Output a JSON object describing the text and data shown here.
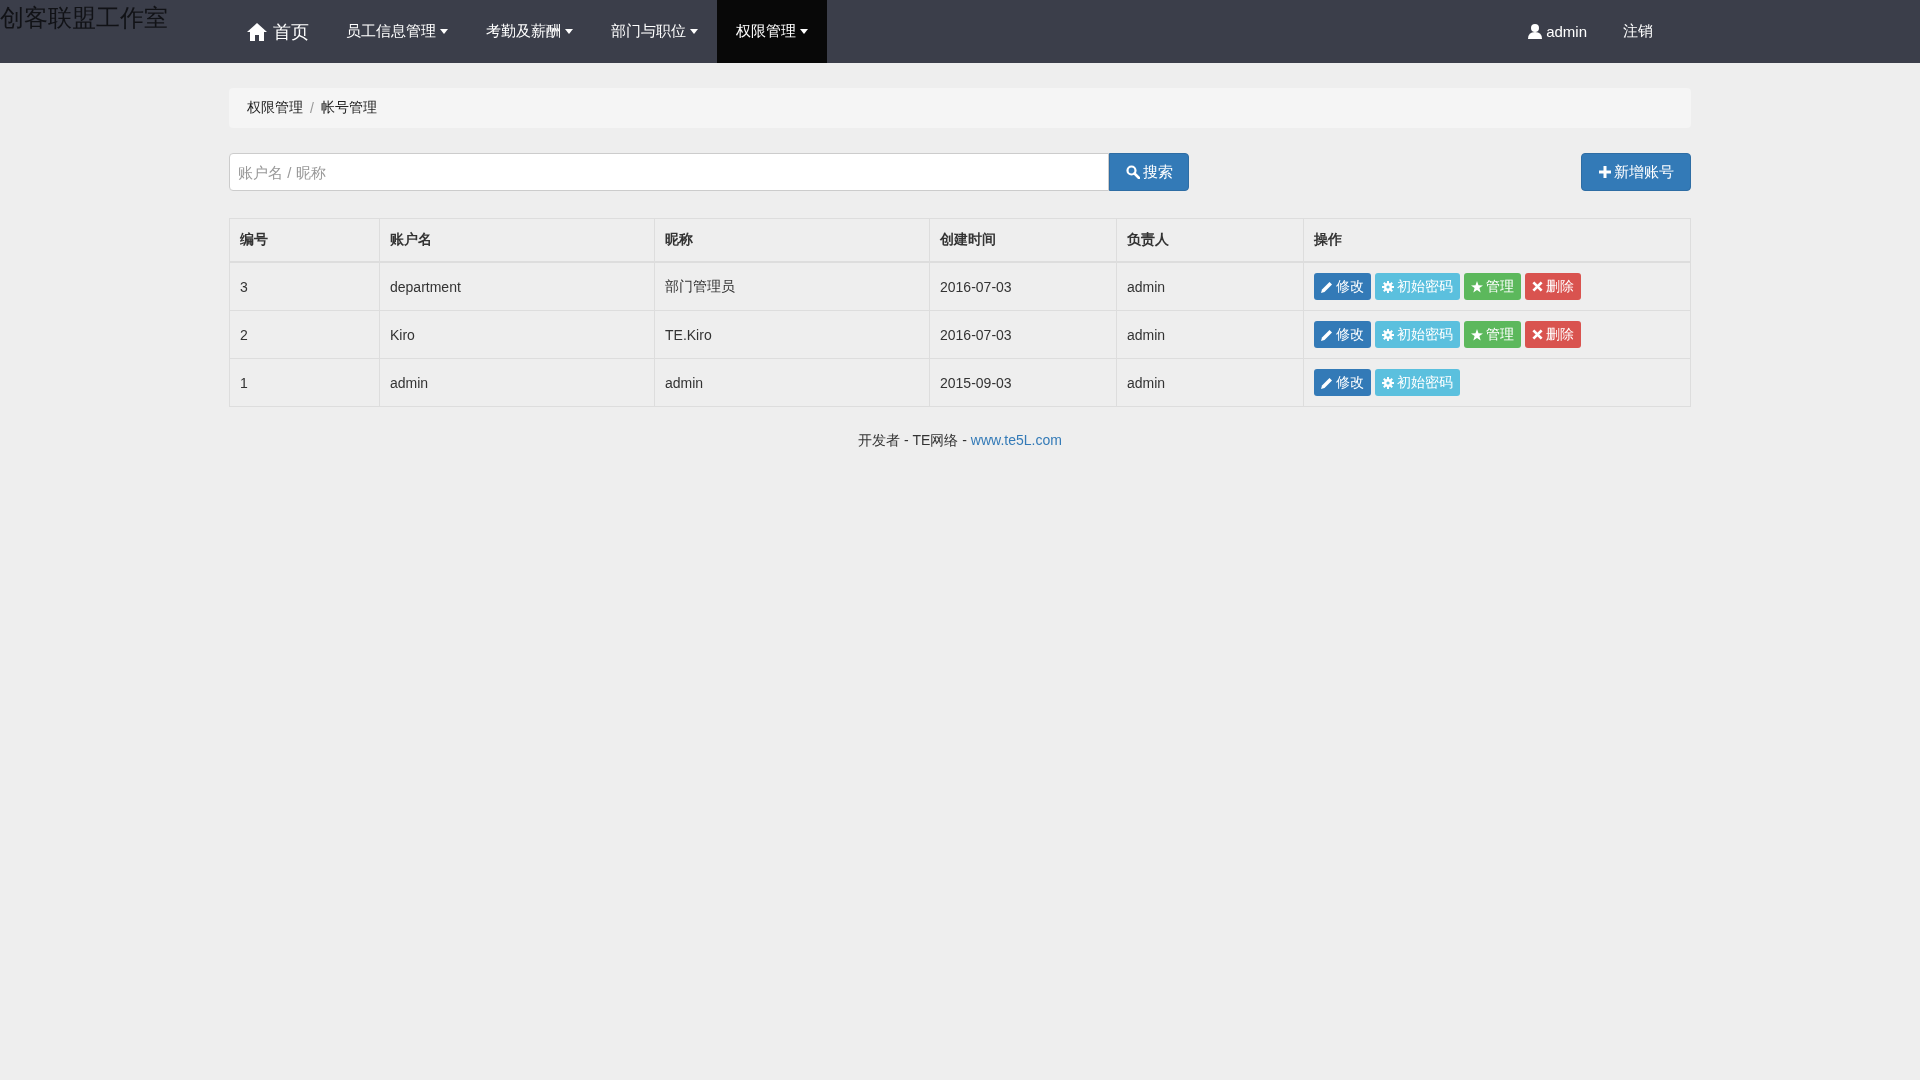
{
  "brand": "创客联盟工作室",
  "nav": {
    "home": "首页",
    "items": [
      {
        "label": "员工信息管理",
        "dropdown": true,
        "selected": false
      },
      {
        "label": "考勤及薪酬",
        "dropdown": true,
        "selected": false
      },
      {
        "label": "部门与职位",
        "dropdown": true,
        "selected": false
      },
      {
        "label": "权限管理",
        "dropdown": true,
        "selected": true
      }
    ],
    "user": "admin",
    "logout": "注销"
  },
  "breadcrumb_separator": "/",
  "breadcrumb": [
    "权限管理",
    "帐号管理"
  ],
  "search": {
    "placeholder": "账户名 / 昵称",
    "button": "搜索"
  },
  "add_button": "新增账号",
  "table": {
    "columns": [
      "编号",
      "账户名",
      "昵称",
      "创建时间",
      "负责人",
      "操作"
    ],
    "rows": [
      {
        "cells": [
          "3",
          "department",
          "部门管理员",
          "2016-07-03",
          "admin"
        ],
        "actions": [
          {
            "kind": "edit",
            "label": "修改"
          },
          {
            "kind": "reset",
            "label": "初始密码"
          },
          {
            "kind": "manage",
            "label": "管理"
          },
          {
            "kind": "delete",
            "label": "删除"
          }
        ]
      },
      {
        "cells": [
          "2",
          "Kiro",
          "TE.Kiro",
          "2016-07-03",
          "admin"
        ],
        "actions": [
          {
            "kind": "edit",
            "label": "修改"
          },
          {
            "kind": "reset",
            "label": "初始密码"
          },
          {
            "kind": "manage",
            "label": "管理"
          },
          {
            "kind": "delete",
            "label": "删除"
          }
        ]
      },
      {
        "cells": [
          "1",
          "admin",
          "admin",
          "2015-09-03",
          "admin"
        ],
        "actions": [
          {
            "kind": "edit",
            "label": "修改"
          },
          {
            "kind": "reset",
            "label": "初始密码"
          }
        ]
      }
    ]
  },
  "footer": {
    "text": "开发者 - TE网络 - ",
    "link": "www.te5L.com"
  }
}
